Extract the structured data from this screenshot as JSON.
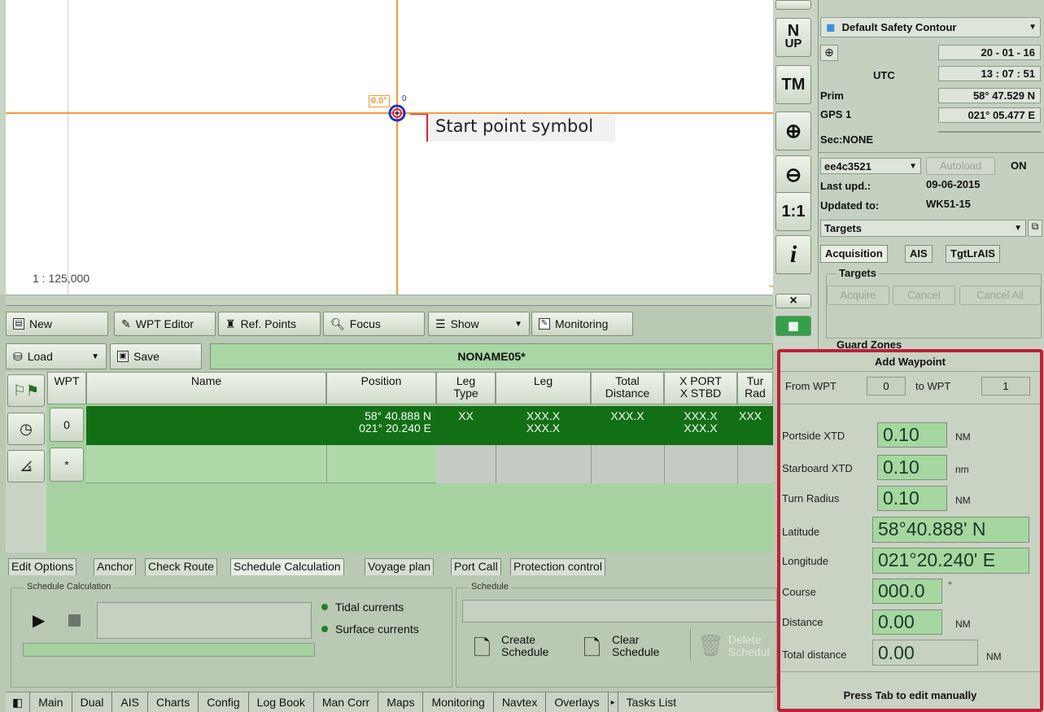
{
  "chart": {
    "cog_label": "0.0°",
    "zero_label": "0",
    "callout": "Start point symbol",
    "scale": "1 : 125,000"
  },
  "toolbar": {
    "new": "New",
    "wpt_editor": "WPT Editor",
    "ref_points": "Ref. Points",
    "focus": "Focus",
    "show": "Show",
    "monitoring": "Monitoring",
    "load": "Load",
    "save": "Save",
    "route_name": "NONAME05*"
  },
  "table": {
    "headers": [
      "WPT",
      "Name",
      "Position",
      "Leg\nType",
      "Leg",
      "Total\nDistance",
      "X PORT\nX STBD",
      "Tur\nRad"
    ],
    "rows": [
      {
        "wpt": "0",
        "name": "",
        "position1": "58° 40.888 N",
        "position2": "021° 20.240 E",
        "leg_type": "XX",
        "leg1": "XXX.X",
        "leg2": "XXX.X",
        "total": "XXX.X",
        "xport": "XXX.X",
        "xstbd": "XXX.X",
        "rad": "XXX"
      },
      {
        "wpt": "*"
      }
    ]
  },
  "tabs": [
    "Edit Options",
    "Anchor",
    "Check Route",
    "Schedule Calculation",
    "Voyage plan",
    "Port Call",
    "Protection control"
  ],
  "schedule_calc": {
    "group": "Schedule Calculation",
    "tidal": "Tidal currents",
    "surface": "Surface currents"
  },
  "schedule": {
    "group": "Schedule",
    "create1": "Create",
    "create2": "Schedule",
    "clear1": "Clear",
    "clear2": "Schedule",
    "delete1": "Delete",
    "delete2": "Schedul"
  },
  "statusbar": [
    "Main",
    "Dual",
    "AIS",
    "Charts",
    "Config",
    "Log Book",
    "Man Corr",
    "Maps",
    "Monitoring",
    "Navtex",
    "Overlays",
    "Tasks List"
  ],
  "nav_buttons": {
    "north_up1": "N",
    "north_up2": "UP",
    "tm": "TM",
    "one_to_one": "1:1",
    "info": "i",
    "close": "×"
  },
  "right": {
    "safety_contour": "Default Safety Contour",
    "date": "20 - 01 - 16",
    "utc_label": "UTC",
    "time": "13 : 07 : 51",
    "prim_label": "Prim",
    "lat": "58° 47.529 N",
    "gps_label": "GPS 1",
    "lon": "021° 05.477 E",
    "sec_label": "Sec:NONE",
    "chart_id": "ee4c3521",
    "autoload": "Autoload",
    "on": "ON",
    "last_upd_label": "Last upd.:",
    "last_upd": "09-06-2015",
    "updated_to_label": "Updated to:",
    "updated_to": "WK51-15",
    "targets_select": "Targets",
    "tab_acq": "Acquisition",
    "tab_ais": "AIS",
    "tab_tgt": "TgtLrAIS",
    "targets_group": "Targets",
    "acquire": "Acquire",
    "cancel": "Cancel",
    "cancel_all": "Cancel All",
    "guard_zones": "Guard Zones"
  },
  "dialog": {
    "title": "Add Waypoint",
    "from_wpt_label": "From WPT",
    "from_wpt": "0",
    "to_wpt_label": "to WPT",
    "to_wpt": "1",
    "portside_label": "Portside XTD",
    "portside": "0.10",
    "portside_unit": "NM",
    "starboard_label": "Starboard XTD",
    "starboard": "0.10",
    "starboard_unit": "nm",
    "turn_label": "Turn Radius",
    "turn": "0.10",
    "turn_unit": "NM",
    "lat_label": "Latitude",
    "lat": "58°40.888' N",
    "lon_label": "Longitude",
    "lon": "021°20.240' E",
    "course_label": "Course",
    "course": "000.0",
    "course_unit": "°",
    "distance_label": "Distance",
    "distance": "0.00",
    "distance_unit": "NM",
    "total_label": "Total distance",
    "total": "0.00",
    "total_unit": "NM",
    "footer": "Press Tab to edit manually"
  },
  "colors": {
    "route_highlight": "#136f15",
    "table_bg": "#a6d1a1",
    "dialog_border": "#c11e36",
    "chart_line": "#f29a3a"
  }
}
